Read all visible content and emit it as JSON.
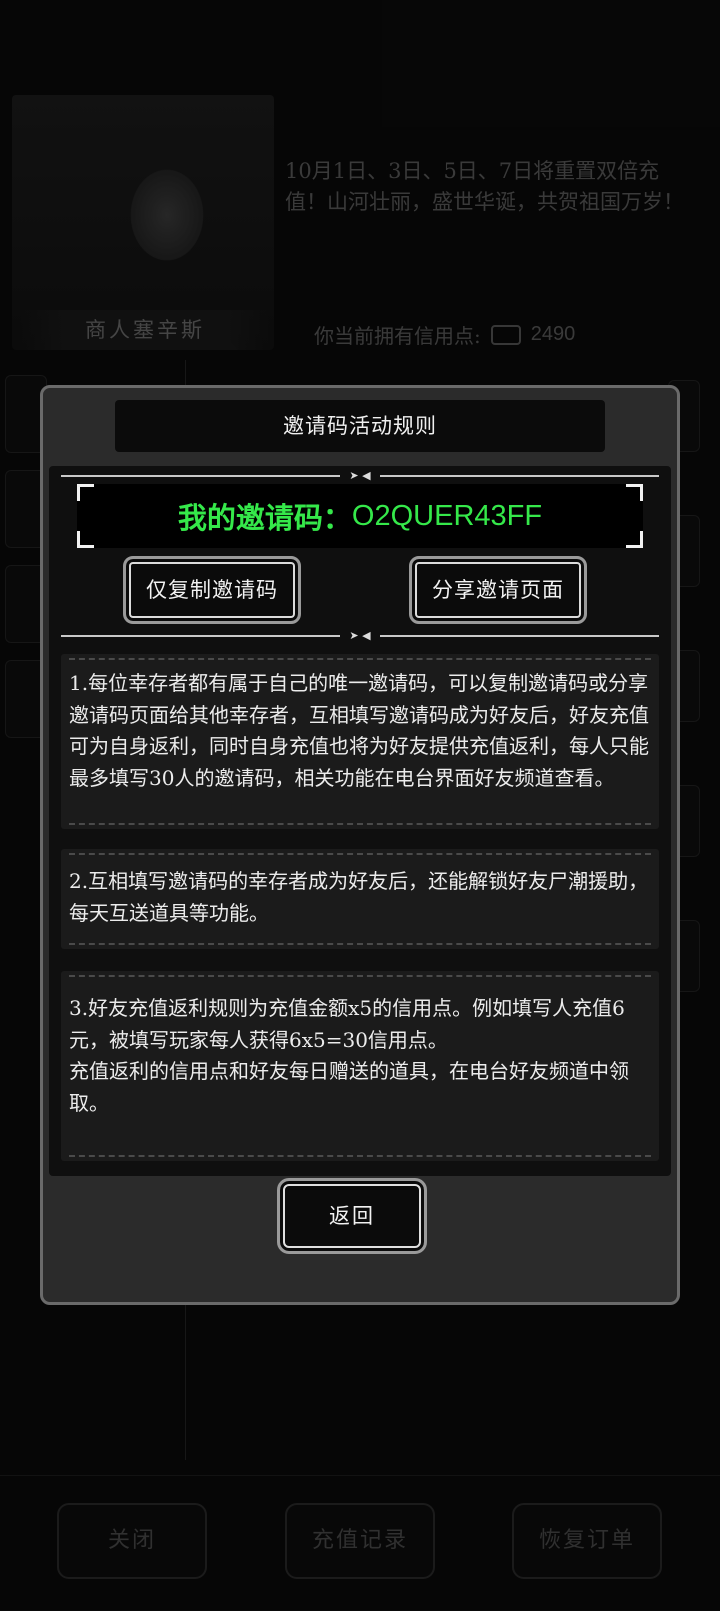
{
  "background": {
    "merchant_name": "商人塞辛斯",
    "announcement": "10月1日、3日、5日、7日将重置双倍充值！山河壮丽，盛世华诞，共贺祖国万岁！",
    "credits_label": "你当前拥有信用点:",
    "credits_value": "2490",
    "credit_icon": "credit-card-icon",
    "bottom_buttons": {
      "close": "关闭",
      "recharge_history": "充值记录",
      "restore_order": "恢复订单"
    }
  },
  "dialog": {
    "title": "邀请码活动规则",
    "code_label": "我的邀请码：",
    "code_value": "O2QUER43FF",
    "copy_button": "仅复制邀请码",
    "share_button": "分享邀请页面",
    "rules": [
      "1.每位幸存者都有属于自己的唯一邀请码，可以复制邀请码或分享邀请码页面给其他幸存者，互相填写邀请码成为好友后，好友充值可为自身返利，同时自身充值也将为好友提供充值返利，每人只能最多填写30人的邀请码，相关功能在电台界面好友频道查看。",
      "2.互相填写邀请码的幸存者成为好友后，还能解锁好友尸潮援助，每天互送道具等功能。",
      "3.好友充值返利规则为充值金额x5的信用点。例如填写人充值6元，被填写玩家每人获得6x5=30信用点。",
      "充值返利的信用点和好友每日赠送的道具，在电台好友频道中领取。"
    ],
    "back_button": "返回"
  },
  "colors": {
    "code_green": "#35e84a",
    "dialog_bg": "#2b2b2b",
    "panel_bg": "#0f0f0f"
  }
}
